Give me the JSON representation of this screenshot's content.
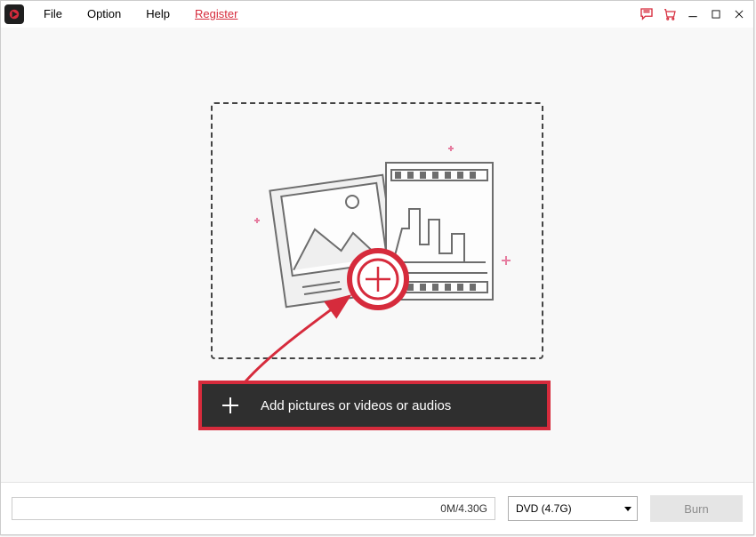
{
  "menu": {
    "file": "File",
    "option": "Option",
    "help": "Help",
    "register": "Register"
  },
  "dropzone": {
    "add_label": "Add pictures or videos or audios"
  },
  "bottom": {
    "progress": "0M/4.30G",
    "disc_option": "DVD (4.7G)",
    "burn": "Burn"
  },
  "colors": {
    "accent": "#d62b3c"
  }
}
